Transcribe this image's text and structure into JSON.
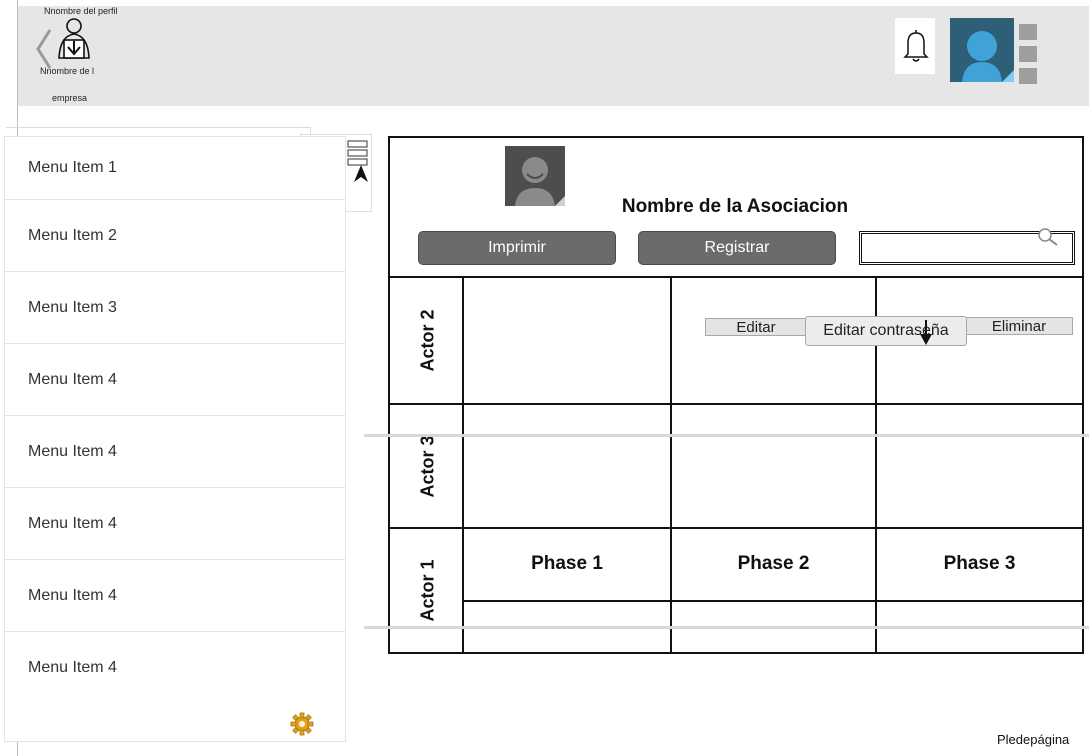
{
  "header": {
    "profile_name": "Nnombre del perfil",
    "company_name_line1": "Nnombre de l",
    "company_name_line2": "empresa"
  },
  "icons": {
    "back": "chevron-left",
    "profile": "user-download",
    "bell": "bell",
    "avatar": "user-avatar",
    "grid_menu": "list-grid",
    "cursor": "mouse-pointer",
    "gear": "gear",
    "search": "magnifier",
    "arrow": "arrow-down"
  },
  "sidebar": {
    "items": [
      {
        "label": "Menu Item 1"
      },
      {
        "label": "Menu Item 2"
      },
      {
        "label": "Menu Item 3"
      },
      {
        "label": "Menu Item 4"
      },
      {
        "label": "Menu Item 4"
      },
      {
        "label": "Menu Item 4"
      },
      {
        "label": "Menu Item 4"
      },
      {
        "label": "Menu Item 4"
      }
    ]
  },
  "main": {
    "title": "Nombre de la Asociacion",
    "print_label": "Imprimir",
    "register_label": "Registrar",
    "search_value": "",
    "actors": [
      "Actor 2",
      "Actor 3",
      "Actor 1"
    ],
    "phases": [
      "Phase 1",
      "Phase 2",
      "Phase 3"
    ],
    "actions": {
      "edit": "Editar",
      "edit_password": "Editar contraseña",
      "delete": "Eliminar"
    }
  },
  "footer": {
    "text": "Pledepágina"
  },
  "colors": {
    "header_bg": "#e6e6e6",
    "avatar_bg": "#2f5f77",
    "button_bg": "#6b6b6b",
    "gear": "#e0a020"
  }
}
